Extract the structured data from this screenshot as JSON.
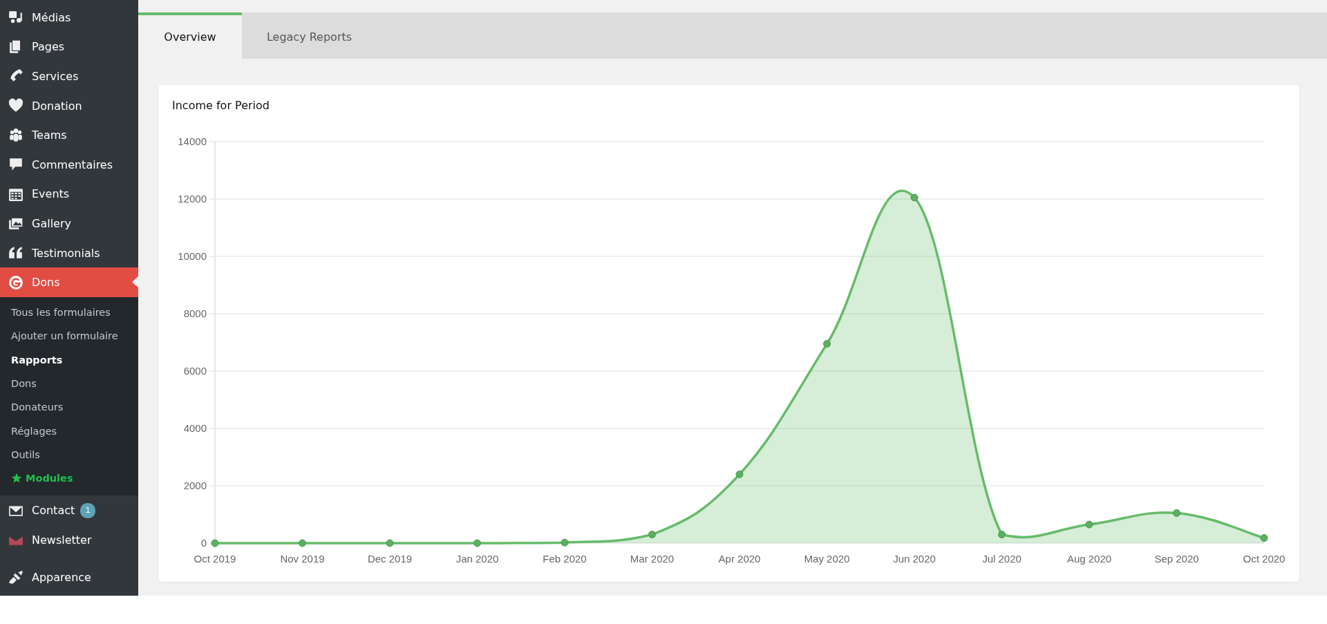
{
  "sidebar": {
    "items": [
      {
        "label": "Médias",
        "selected": false
      },
      {
        "label": "Pages",
        "selected": false
      },
      {
        "label": "Services",
        "selected": false
      },
      {
        "label": "Donation",
        "selected": false
      },
      {
        "label": "Teams",
        "selected": false
      },
      {
        "label": "Commentaires",
        "selected": false
      },
      {
        "label": "Events",
        "selected": false
      },
      {
        "label": "Gallery",
        "selected": false
      },
      {
        "label": "Testimonials",
        "selected": false
      },
      {
        "label": "Dons",
        "selected": true,
        "submenu": [
          {
            "label": "Tous les formulaires",
            "selected": false
          },
          {
            "label": "Ajouter un formulaire",
            "selected": false
          },
          {
            "label": "Rapports",
            "selected": true
          },
          {
            "label": "Dons",
            "selected": false
          },
          {
            "label": "Donateurs",
            "selected": false
          },
          {
            "label": "Réglages",
            "selected": false
          },
          {
            "label": "Outils",
            "selected": false
          },
          {
            "label": "Modules",
            "selected": false,
            "kind": "star"
          }
        ]
      },
      {
        "label": "Contact",
        "selected": false,
        "badge": "1"
      },
      {
        "label": "Newsletter",
        "selected": false
      },
      {
        "label": "Apparence",
        "selected": false
      }
    ]
  },
  "tabs": [
    {
      "label": "Overview",
      "selected": true
    },
    {
      "label": "Legacy Reports",
      "selected": false
    }
  ],
  "card": {
    "title": "Income for Period",
    "chart_data": {
      "type": "area",
      "categories": [
        "Oct 2019",
        "Nov 2019",
        "Dec 2019",
        "Jan 2020",
        "Feb 2020",
        "Mar 2020",
        "Apr 2020",
        "May 2020",
        "Jun 2020",
        "Jul 2020",
        "Aug 2020",
        "Sep 2020",
        "Oct 2020"
      ],
      "grid": true,
      "series": [
        {
          "color": "#66bb6a",
          "values": [
            0,
            0,
            0,
            0,
            20,
            300,
            2400,
            6950,
            12050,
            300,
            650,
            1050,
            180
          ]
        }
      ],
      "ylim": [
        0,
        14000
      ],
      "yticks": [
        0,
        2000,
        4000,
        6000,
        8000,
        10000,
        12000,
        14000
      ]
    }
  }
}
